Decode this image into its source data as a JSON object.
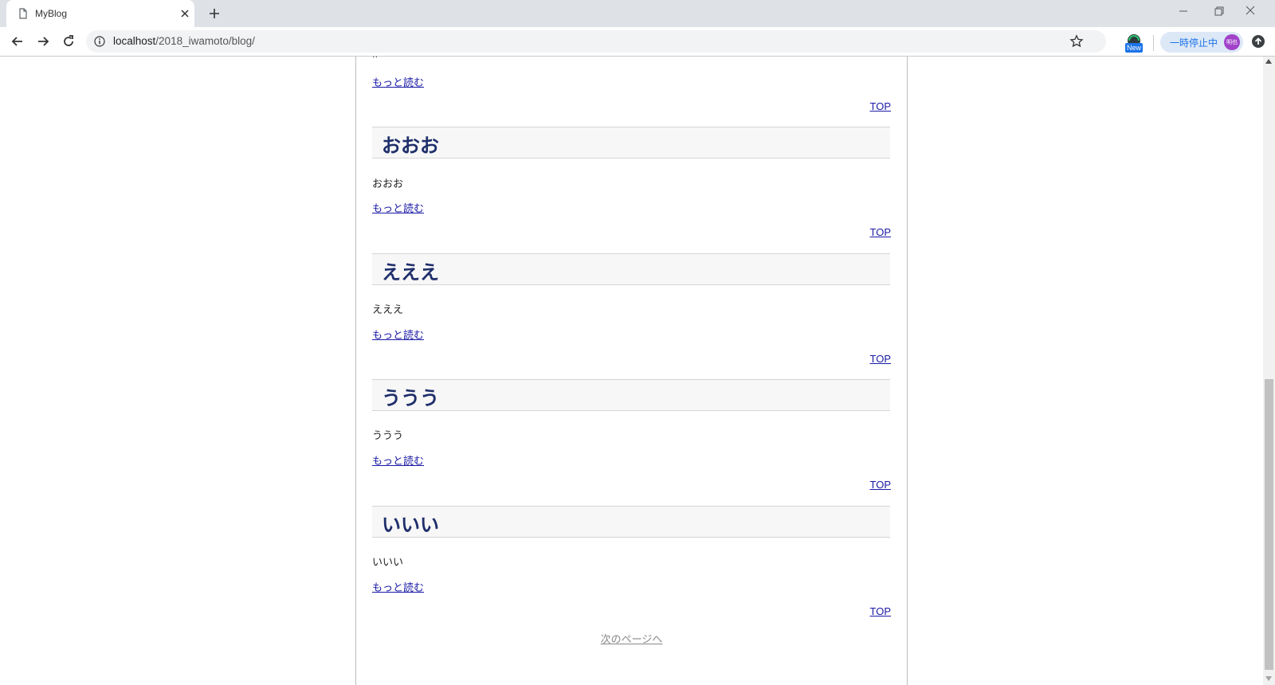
{
  "browser": {
    "tab_title": "MyBlog",
    "url_host": "localhost",
    "url_path": "/2018_iwamoto/blog/",
    "extension_badge": "New",
    "paused_label": "一時停止中",
    "avatar_text": "明也"
  },
  "page": {
    "fragment_text": "ii",
    "read_more_label": "もっと読む",
    "top_label": "TOP",
    "next_page_label": "次のページへ",
    "posts": [
      {
        "title": "おおお",
        "body": "おおお"
      },
      {
        "title": "えええ",
        "body": "えええ"
      },
      {
        "title": "ううう",
        "body": "ううう"
      },
      {
        "title": "いいい",
        "body": "いいい"
      }
    ]
  },
  "colors": {
    "title_text": "#1f2f6b",
    "link": "#1a1aa6",
    "accent": "#1a73e8"
  }
}
